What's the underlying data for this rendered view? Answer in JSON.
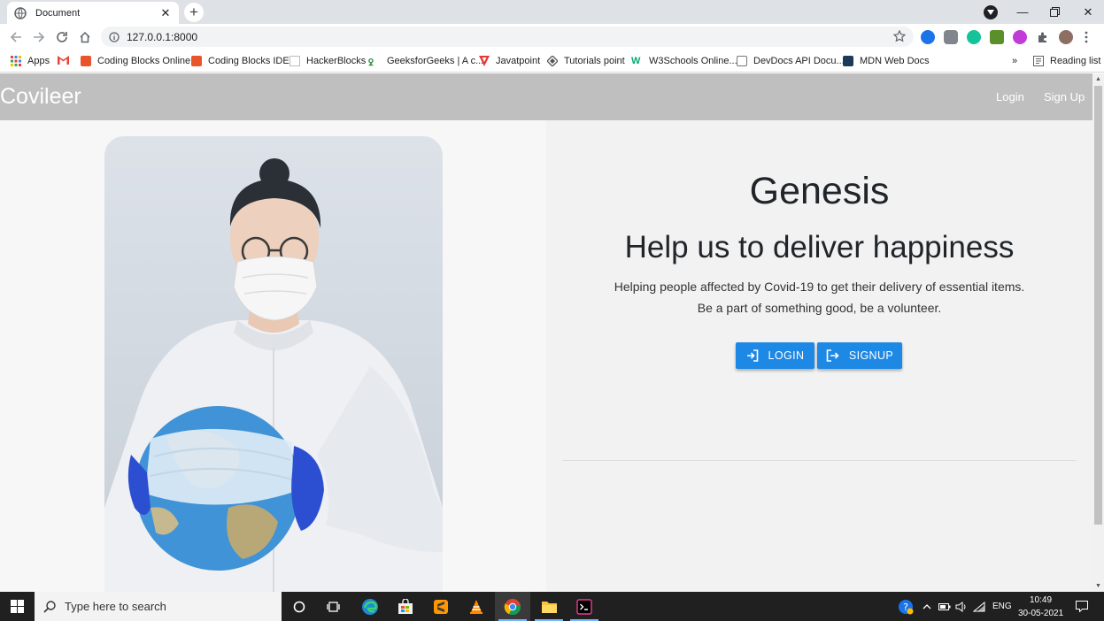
{
  "browser": {
    "tab_title": "Document",
    "url": "127.0.0.1:8000",
    "bookmarks": [
      {
        "label": "Apps",
        "icon": "apps-grid-icon",
        "color": "#ea4335"
      },
      {
        "label": "",
        "icon": "gmail-icon",
        "color": "#ea4335"
      },
      {
        "label": "Coding Blocks Online",
        "icon": "coding-blocks-icon",
        "color": "#e8542b"
      },
      {
        "label": "Coding Blocks IDE",
        "icon": "coding-blocks-icon",
        "color": "#e8542b"
      },
      {
        "label": "HackerBlocks",
        "icon": "page-icon",
        "color": "#bdbdbd"
      },
      {
        "label": "GeeksforGeeks | A c...",
        "icon": "gfg-icon",
        "color": "#2f8d46"
      },
      {
        "label": "Javatpoint",
        "icon": "javatpoint-icon",
        "color": "#e53935"
      },
      {
        "label": "Tutorials point",
        "icon": "tutorialspoint-icon",
        "color": "#555555"
      },
      {
        "label": "W3Schools Online...",
        "icon": "w3schools-icon",
        "color": "#04aa6d"
      },
      {
        "label": "DevDocs API Docu...",
        "icon": "devdocs-icon",
        "color": "#555555"
      },
      {
        "label": "MDN Web Docs",
        "icon": "mdn-icon",
        "color": "#1b3a57"
      }
    ],
    "reading_list": "Reading list",
    "more": "»"
  },
  "navbar": {
    "brand": "Covileer",
    "login": "Login",
    "signup": "Sign Up"
  },
  "hero": {
    "title": "Genesis",
    "tagline": "Help us to deliver happiness",
    "line1": "Helping people affected by Covid-19 to get their delivery of essential items.",
    "line2": "Be a part of something good, be a volunteer.",
    "login_button": "LOGIN",
    "signup_button": "SIGNUP",
    "accent": "#1e88e5"
  },
  "taskbar": {
    "search_placeholder": "Type here to search",
    "lang": "ENG",
    "time": "10:49",
    "date": "30-05-2021"
  }
}
